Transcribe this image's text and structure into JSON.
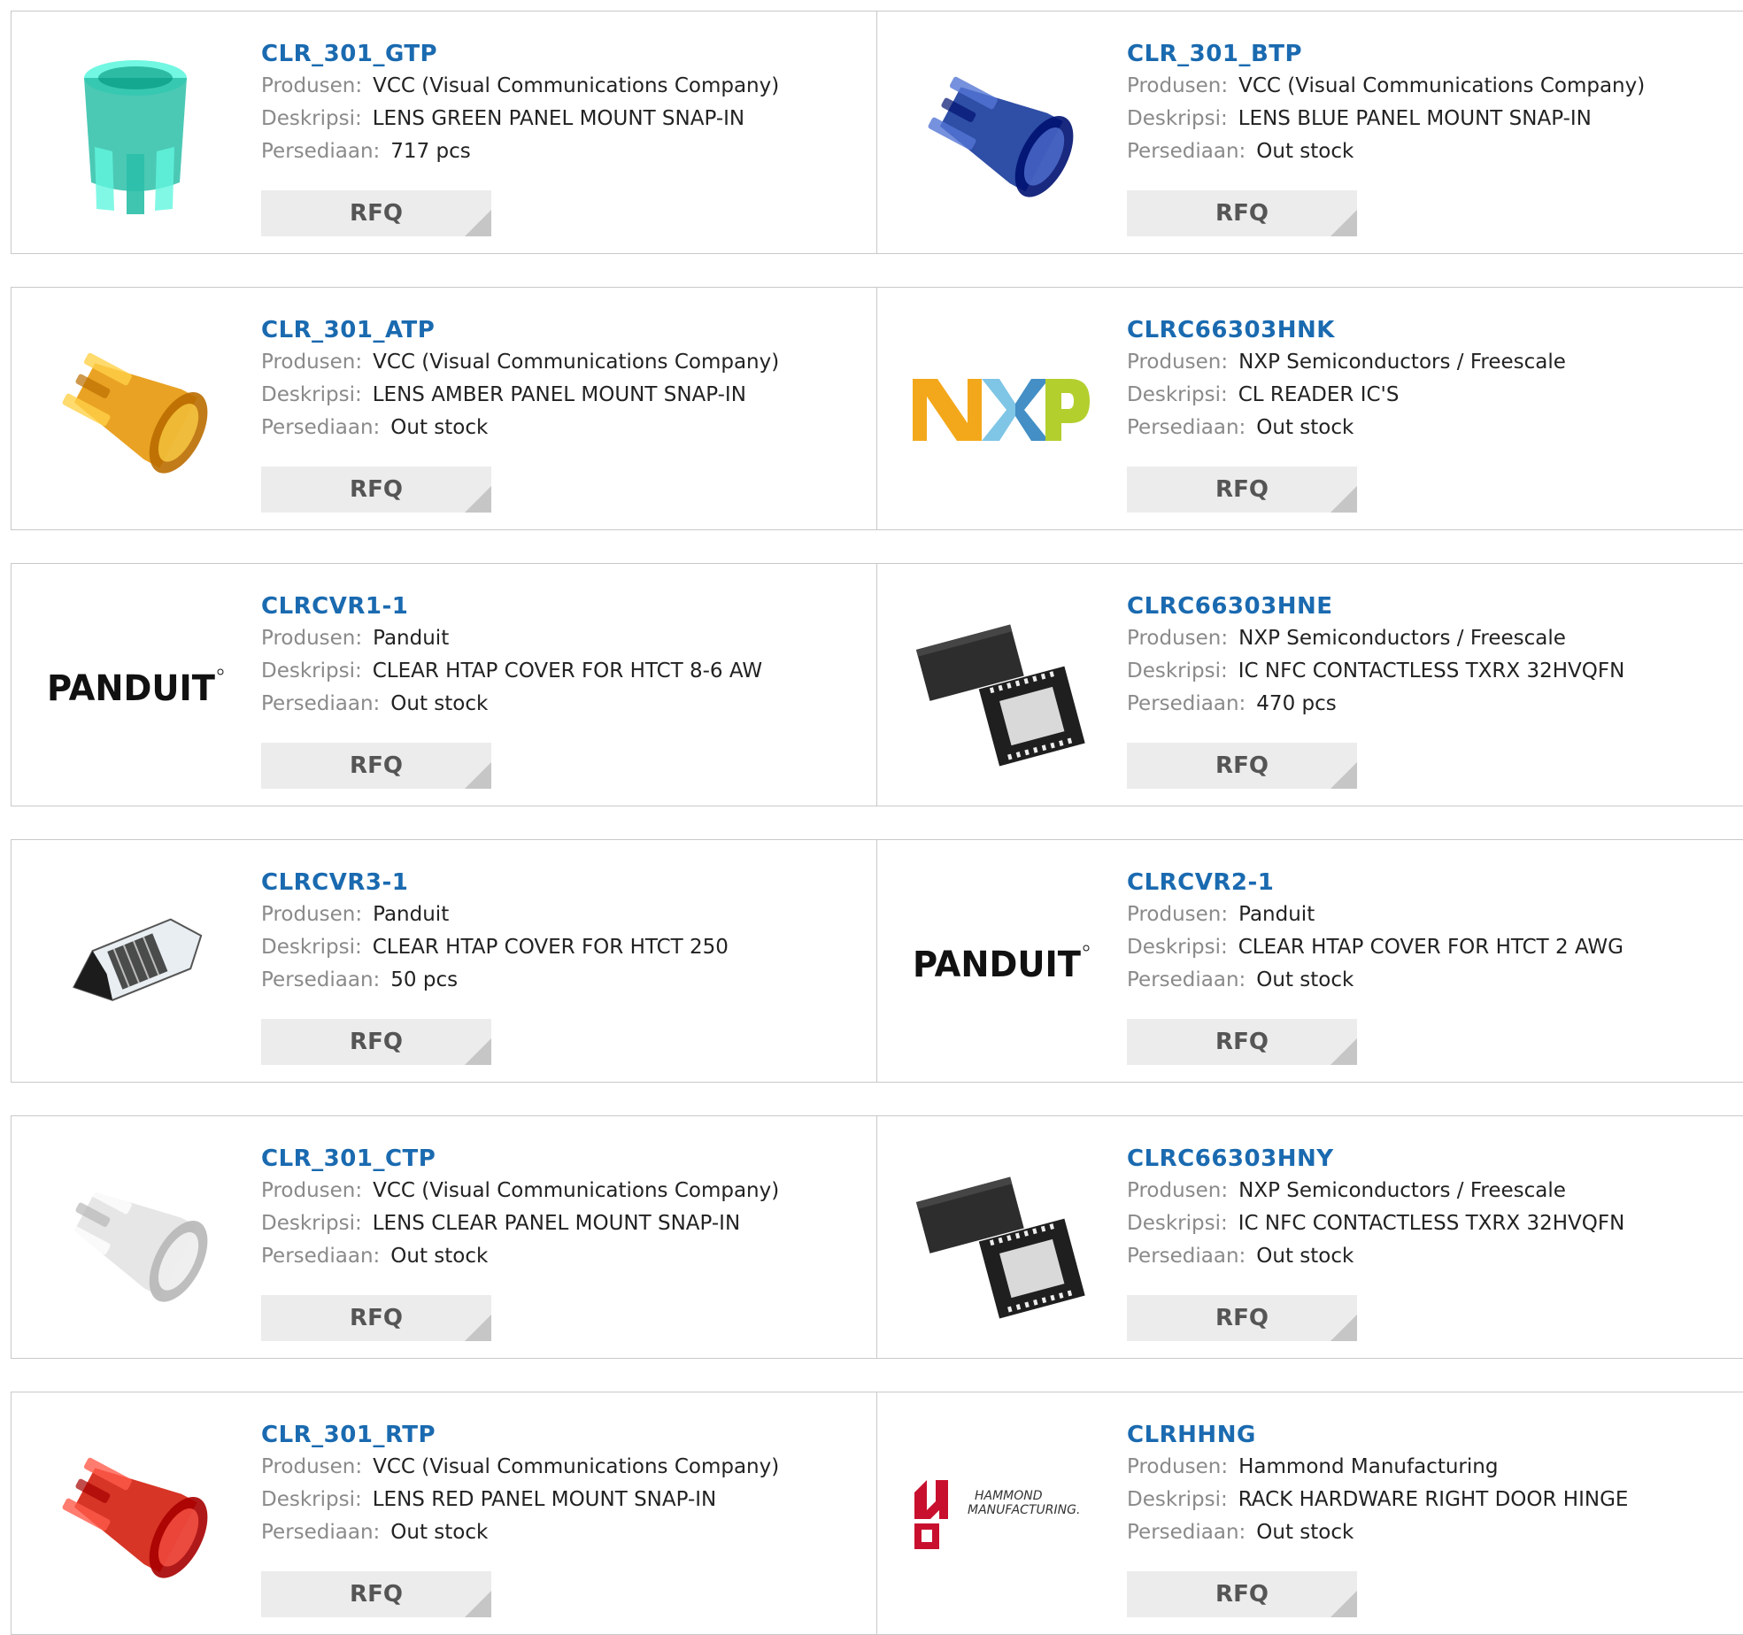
{
  "labels": {
    "manufacturer": "Produsen:",
    "description": "Deskripsi:",
    "stock": "Persediaan:",
    "rfq": "RFQ"
  },
  "products": [
    {
      "part": "CLR_301_GTP",
      "manufacturer": "VCC (Visual Communications Company)",
      "description": "LENS GREEN PANEL MOUNT SNAP-IN",
      "stock": "717 pcs",
      "image": "green-lens-icon",
      "color": "#2bbfa8"
    },
    {
      "part": "CLR_301_BTP",
      "manufacturer": "VCC (Visual Communications Company)",
      "description": "LENS BLUE PANEL MOUNT SNAP-IN",
      "stock": "Out stock",
      "image": "blue-lens-icon",
      "color": "#1d3f9e"
    },
    {
      "part": "CLR_301_ATP",
      "manufacturer": "VCC (Visual Communications Company)",
      "description": "LENS AMBER PANEL MOUNT SNAP-IN",
      "stock": "Out stock",
      "image": "amber-lens-icon",
      "color": "#e79a10"
    },
    {
      "part": "CLRC66303HNK",
      "manufacturer": "NXP Semiconductors / Freescale",
      "description": "CL READER IC'S",
      "stock": "Out stock",
      "image": "nxp-logo",
      "logo_text": "NXP"
    },
    {
      "part": "CLRCVR1-1",
      "manufacturer": "Panduit",
      "description": "CLEAR HTAP COVER FOR HTCT 8-6 AW",
      "stock": "Out stock",
      "image": "panduit-logo",
      "logo_text": "PANDUIT"
    },
    {
      "part": "CLRC66303HNE",
      "manufacturer": "NXP Semiconductors / Freescale",
      "description": "IC NFC CONTACTLESS TXRX 32HVQFN",
      "stock": "470 pcs",
      "image": "qfn-chip-icon"
    },
    {
      "part": "CLRCVR3-1",
      "manufacturer": "Panduit",
      "description": "CLEAR HTAP COVER FOR HTCT 250",
      "stock": "50 pcs",
      "image": "clear-cover-icon"
    },
    {
      "part": "CLRCVR2-1",
      "manufacturer": "Panduit",
      "description": "CLEAR HTAP COVER FOR HTCT 2 AWG",
      "stock": "Out stock",
      "image": "panduit-logo",
      "logo_text": "PANDUIT"
    },
    {
      "part": "CLR_301_CTP",
      "manufacturer": "VCC (Visual Communications Company)",
      "description": "LENS CLEAR PANEL MOUNT SNAP-IN",
      "stock": "Out stock",
      "image": "clear-lens-icon",
      "color": "#e4e4e4"
    },
    {
      "part": "CLRC66303HNY",
      "manufacturer": "NXP Semiconductors / Freescale",
      "description": "IC NFC CONTACTLESS TXRX 32HVQFN",
      "stock": "Out stock",
      "image": "qfn-chip-icon"
    },
    {
      "part": "CLR_301_RTP",
      "manufacturer": "VCC (Visual Communications Company)",
      "description": "LENS RED PANEL MOUNT SNAP-IN",
      "stock": "Out stock",
      "image": "red-lens-icon",
      "color": "#d42414"
    },
    {
      "part": "CLRHHNG",
      "manufacturer": "Hammond Manufacturing",
      "description": "RACK HARDWARE RIGHT DOOR HINGE",
      "stock": "Out stock",
      "image": "hammond-logo",
      "logo_text": "HAMMOND MANUFACTURING."
    }
  ]
}
